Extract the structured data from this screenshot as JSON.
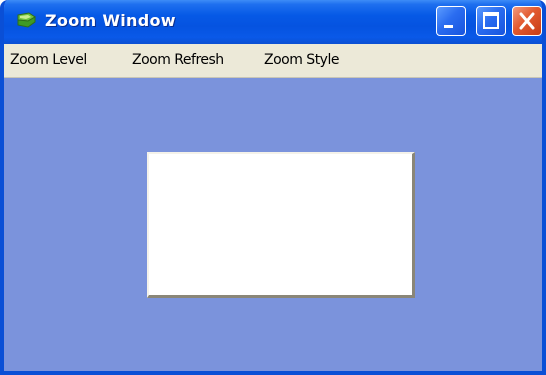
{
  "window": {
    "title": "Zoom Window"
  },
  "titlebar": {
    "icon": "app-icon",
    "buttons": {
      "minimize_icon": "minimize-icon",
      "maximize_icon": "maximize-icon",
      "close_icon": "close-icon"
    }
  },
  "menu": {
    "items": [
      {
        "label": "Zoom Level"
      },
      {
        "label": "Zoom Refresh"
      },
      {
        "label": "Zoom Style"
      }
    ]
  },
  "colors": {
    "client_background": "#7b93dc",
    "title_bar": "#0553e0",
    "menu_bar": "#ece9d8",
    "zoom_panel": "#ffffff",
    "close_button": "#e2592f"
  }
}
